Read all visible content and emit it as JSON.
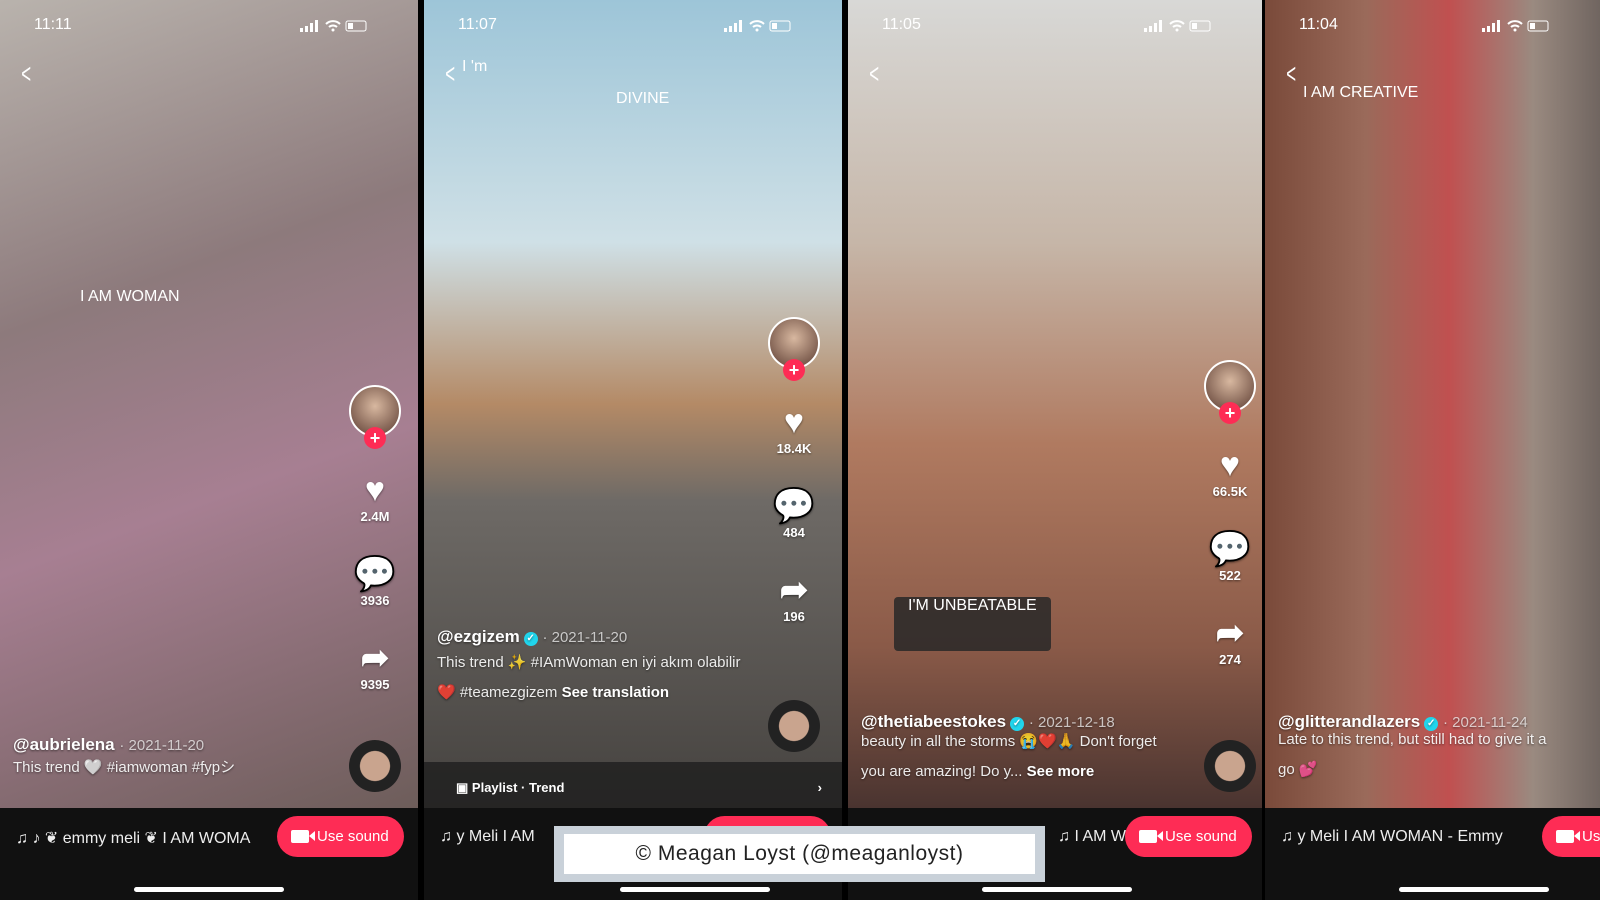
{
  "colors": {
    "accent": "#fe2c55",
    "verified": "#20d5ec",
    "bar": "#111111"
  },
  "icons": {
    "back": "chevron-left-icon",
    "like": "heart-icon",
    "comment": "comment-icon",
    "share": "share-icon",
    "music": "music-note-icon",
    "camera": "video-camera-icon",
    "follow": "plus-icon"
  },
  "panels": [
    {
      "time": "11:11",
      "overlay": "I AM WOMAN",
      "likes": "2.4M",
      "comments": "3936",
      "shares": "9395",
      "username": "@aubrielena",
      "date": "· 2021-11-20",
      "caption": [
        "This trend 🤍 <b>#iamwoman #fyp</b>シ"
      ],
      "caption_plain": "This trend 🤍 #iamwoman #fypシ",
      "sound": "♪ ❦ emmy meli ❦   I AM WOMA",
      "use_sound": "Use sound"
    },
    {
      "time": "11:07",
      "overlay": "I 'm",
      "overlay2": "DIVINE",
      "likes": "18.4K",
      "comments": "484",
      "shares": "196",
      "username": "@ezgizem",
      "verified": true,
      "date": "· 2021-11-20",
      "caption_plain": "This trend ✨ #IAmWoman en iyi akım olabilir ❤️ #teamezgizem",
      "see": "See translation",
      "playlist": "Playlist · Trend",
      "sound": "y Meli   I AM",
      "use_sound": "Use sound"
    },
    {
      "time": "11:05",
      "overlay": "I'M UNBEATABLE",
      "likes": "66.5K",
      "comments": "522",
      "shares": "274",
      "username": "@thetiabeestokes",
      "verified": true,
      "date": "· 2021-12-18",
      "caption_plain": "beauty in all the storms 😭❤️🙏 Don't forget you are amazing! Do y...",
      "see": "See more",
      "watermark_user": "thetiabeestokes",
      "sound": "I AM W",
      "use_sound": "Use sound"
    },
    {
      "time": "11:04",
      "overlay": "I AM CREATIVE",
      "username": "@glitterandlazers",
      "verified": true,
      "date": "· 2021-11-24",
      "caption_plain": "Late to this trend, but still had to give it a go 💕",
      "sound": "y Meli   I AM WOMAN - Emmy",
      "use_sound": "Use sound"
    }
  ],
  "watermark": "© Meagan Loyst (@meaganloyst)"
}
